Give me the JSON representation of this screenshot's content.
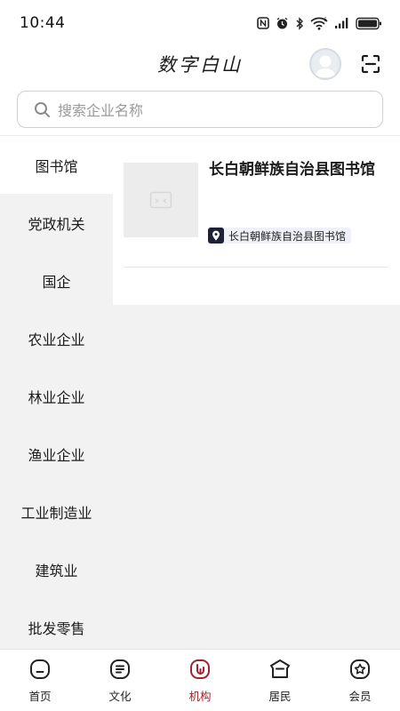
{
  "status_bar": {
    "time": "10:44",
    "network_label": "6"
  },
  "header": {
    "title": "数字白山"
  },
  "search": {
    "placeholder": "搜索企业名称"
  },
  "sidebar": {
    "items": [
      {
        "label": "图书馆",
        "active": true
      },
      {
        "label": "党政机关"
      },
      {
        "label": "国企"
      },
      {
        "label": "农业企业"
      },
      {
        "label": "林业企业"
      },
      {
        "label": "渔业企业"
      },
      {
        "label": "工业制造业"
      },
      {
        "label": "建筑业"
      },
      {
        "label": "批发零售"
      }
    ]
  },
  "list": {
    "items": [
      {
        "title": "长白朝鲜族自治县图书馆",
        "location_tag": "长白朝鲜族自治县图书馆"
      }
    ]
  },
  "tabbar": {
    "items": [
      {
        "label": "首页",
        "icon": "home-icon"
      },
      {
        "label": "文化",
        "icon": "culture-icon"
      },
      {
        "label": "机构",
        "icon": "organization-icon",
        "active": true
      },
      {
        "label": "居民",
        "icon": "resident-icon"
      },
      {
        "label": "会员",
        "icon": "member-icon"
      }
    ],
    "active_color": "#a0242b"
  }
}
